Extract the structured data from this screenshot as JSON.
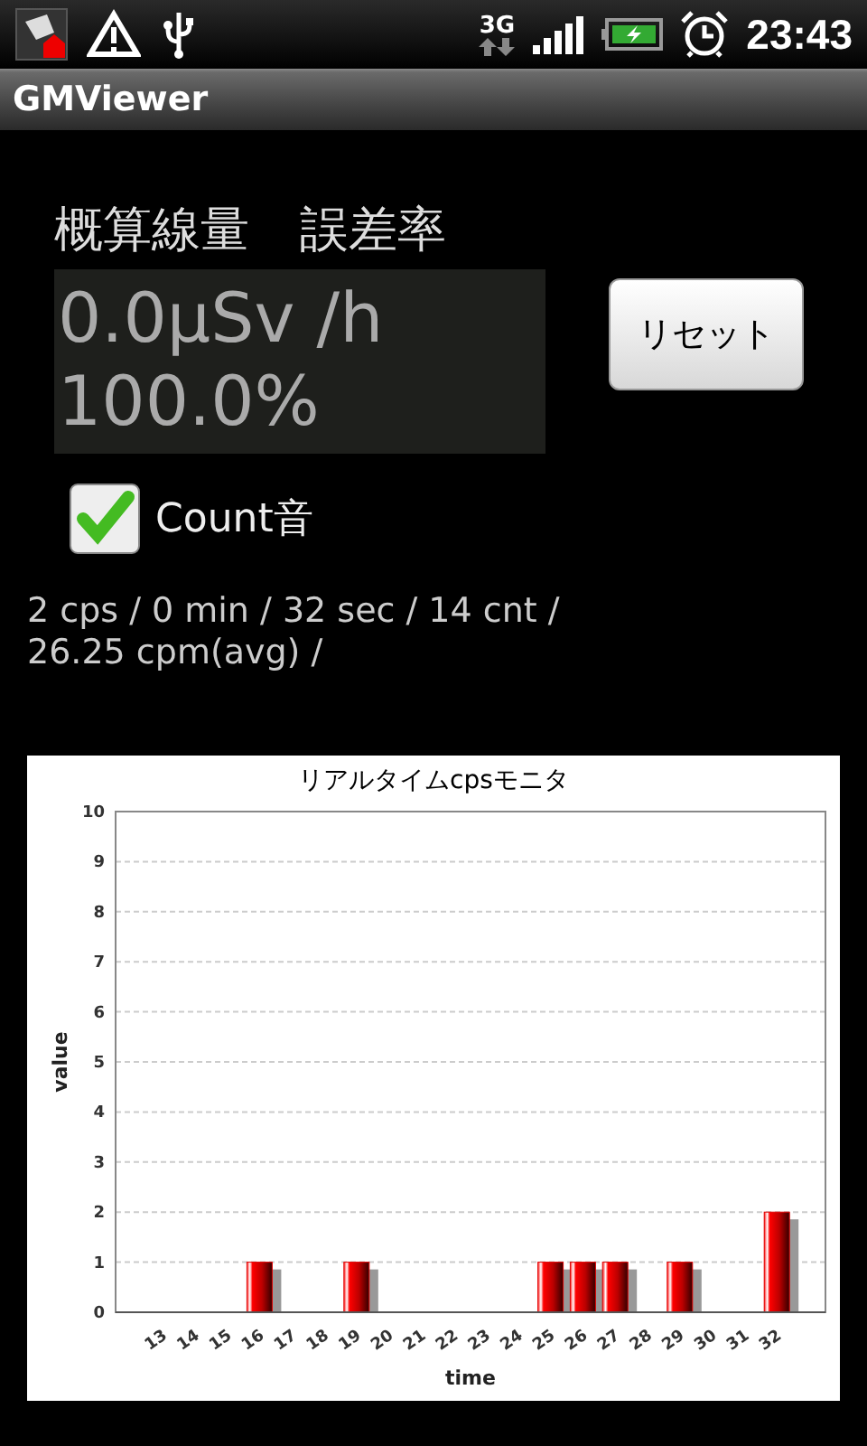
{
  "status_bar": {
    "network": "3G",
    "time": "23:43"
  },
  "app_bar": {
    "title": "GMViewer"
  },
  "labels": {
    "dose": "概算線量",
    "error": "誤差率"
  },
  "readout": {
    "dose": "0.0μSv /h",
    "error": "100.0%"
  },
  "reset_button": "リセット",
  "sound_checkbox": {
    "label": "Count音",
    "checked": true
  },
  "stats": [
    "2 cps / 0 min / 32 sec / 14 cnt /",
    "26.25 cpm(avg) /"
  ],
  "chart": {
    "chart_data": {
      "type": "bar",
      "title": "リアルタイムcpsモニタ",
      "xlabel": "time",
      "ylabel": "value",
      "categories": [
        "13",
        "14",
        "15",
        "16",
        "17",
        "18",
        "19",
        "20",
        "21",
        "22",
        "23",
        "24",
        "25",
        "26",
        "27",
        "28",
        "29",
        "30",
        "31",
        "32"
      ],
      "grid": true,
      "series": [
        {
          "color": "#e00000",
          "values": [
            0,
            0,
            0,
            1,
            0,
            0,
            1,
            0,
            0,
            0,
            0,
            0,
            1,
            1,
            1,
            0,
            1,
            0,
            0,
            2
          ]
        }
      ],
      "ylim": [
        0,
        10
      ],
      "yticks": [
        0,
        1,
        2,
        3,
        4,
        5,
        6,
        7,
        8,
        9,
        10
      ]
    }
  }
}
